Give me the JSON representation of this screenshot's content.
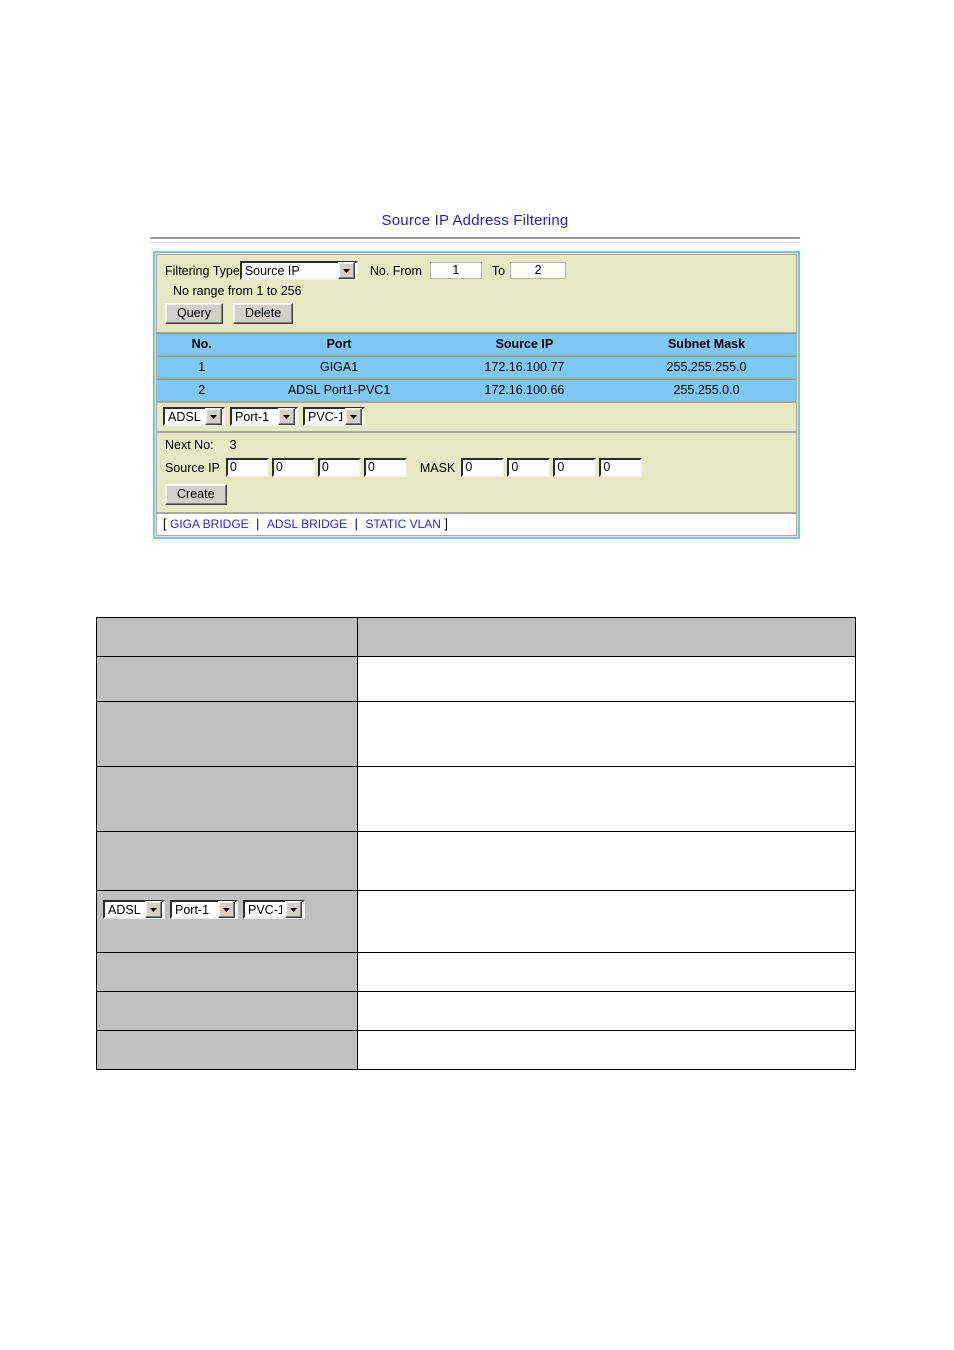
{
  "page": {
    "title": "Source IP Address Filtering"
  },
  "filter": {
    "filtering_type_label": "Filtering Type",
    "filtering_type_value": "Source IP",
    "filtering_type_options": [
      "Source IP"
    ],
    "no_from_label": "No. From",
    "no_from_value": "1",
    "no_to_label": "To",
    "no_to_value": "2",
    "range_hint": "No range from 1 to 256",
    "query_button": "Query",
    "delete_button": "Delete"
  },
  "results": {
    "columns": [
      "No.",
      "Port",
      "Source IP",
      "Subnet Mask"
    ],
    "rows": [
      {
        "no": "1",
        "port": "GIGA1",
        "source_ip": "172.16.100.77",
        "subnet_mask": "255.255.255.0"
      },
      {
        "no": "2",
        "port": "ADSL Port1-PVC1",
        "source_ip": "172.16.100.66",
        "subnet_mask": "255.255.0.0"
      }
    ]
  },
  "port_selector": {
    "type_value": "ADSL",
    "type_options": [
      "ADSL"
    ],
    "port_value": "Port-1",
    "port_options": [
      "Port-1"
    ],
    "pvc_value": "PVC-1",
    "pvc_options": [
      "PVC-1"
    ]
  },
  "create": {
    "next_no_label": "Next No:",
    "next_no_value": "3",
    "source_ip_label": "Source IP",
    "source_ip_octets": [
      "0",
      "0",
      "0",
      "0"
    ],
    "mask_label": "MASK",
    "mask_octets": [
      "0",
      "0",
      "0",
      "0"
    ],
    "create_button": "Create"
  },
  "footer": {
    "open_bracket": "[",
    "close_bracket": "]",
    "links": [
      "GIGA BRIDGE",
      "ADSL BRIDGE",
      "STATIC VLAN"
    ],
    "separator": "|"
  },
  "description_table": {
    "header": {
      "key": "",
      "value": ""
    },
    "rows": [
      {
        "key": "",
        "value": ""
      },
      {
        "key": "",
        "value": ""
      },
      {
        "key": "",
        "value": ""
      },
      {
        "key": "",
        "value": ""
      },
      {
        "key": "",
        "value": ""
      },
      {
        "key": "",
        "value": ""
      },
      {
        "key": "",
        "value": ""
      }
    ],
    "selector_row": {
      "type_value": "ADSL",
      "port_value": "Port-1",
      "pvc_value": "PVC-1",
      "value": ""
    }
  },
  "colors": {
    "title_blue": "#2222cc",
    "panel_border": "#7ec0ee",
    "panel_bg": "#e6e8c3",
    "table_blue": "#7ec8f5",
    "link_blue": "#2828e0",
    "desc_key_bg": "#c0c0c0"
  }
}
